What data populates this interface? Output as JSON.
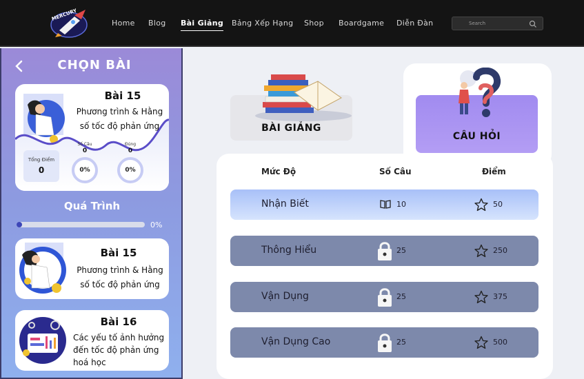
{
  "nav": {
    "logo_text": "MERCURY",
    "items": [
      {
        "label": "Home",
        "active": false
      },
      {
        "label": "Blog",
        "active": false
      },
      {
        "label": "Bài Giảng",
        "active": true
      },
      {
        "label": "Bảng Xếp Hạng",
        "active": false
      },
      {
        "label": "Shop",
        "active": false
      },
      {
        "label": "Boardgame",
        "active": false
      },
      {
        "label": "Diễn Đàn",
        "active": false
      }
    ],
    "search_placeholder": "Search"
  },
  "sidebar": {
    "title": "CHỌN BÀI",
    "current_lesson": {
      "number": "Bài 15",
      "name_line1": "Phương trình & Hằng",
      "name_line2": "số tốc độ phản ứng",
      "total_score_label": "Tổng Điểm",
      "total_score": "0",
      "questions_label": "Số Câu",
      "questions_value": "0",
      "correct_label": "Đúng",
      "correct_value": "0",
      "ring1_pct": "0%",
      "ring2_pct": "0%"
    },
    "progress": {
      "title": "Quá Trình",
      "percent_text": "0%",
      "value": 0
    },
    "lessons": [
      {
        "number": "Bài 15",
        "name_lines": [
          "Phương trình & Hằng",
          "số tốc độ phản ứng"
        ]
      },
      {
        "number": "Bài 16",
        "name_lines": [
          "Các yếu tố ảnh hưởng",
          "đến tốc độ phản ứng",
          "hoá học"
        ]
      }
    ]
  },
  "modes": {
    "lecture_label": "BÀI GIẢNG",
    "questions_label": "CÂU HỎI"
  },
  "table": {
    "headers": {
      "level": "Mức Độ",
      "count": "Số Câu",
      "points": "Điểm"
    },
    "rows": [
      {
        "level": "Nhận Biết",
        "count": "10",
        "points": "50",
        "locked": false
      },
      {
        "level": "Thông Hiểu",
        "count": "25",
        "points": "250",
        "locked": true
      },
      {
        "level": "Vận Dụng",
        "count": "25",
        "points": "375",
        "locked": true
      },
      {
        "level": "Vận Dụng Cao",
        "count": "25",
        "points": "500",
        "locked": true
      }
    ]
  },
  "colors": {
    "navbar": "#141414",
    "accent_purple": "#9b8ad8",
    "row_open": "#b8cdfa",
    "row_locked": "#7d89ab",
    "selected_mode": "#a38cf0"
  }
}
